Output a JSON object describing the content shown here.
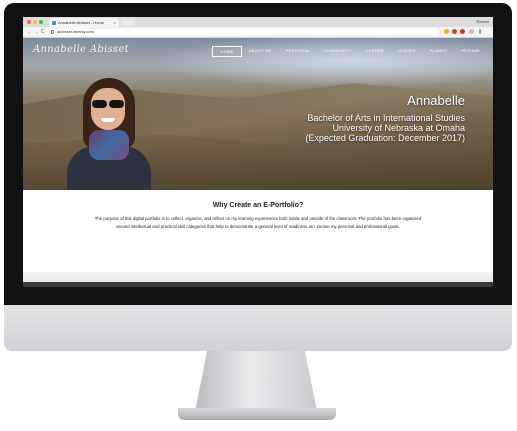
{
  "browser": {
    "tab_title": "Annabelle Abisset - Home",
    "tab_close": "×",
    "profile_name": "Rachel",
    "url": "aabisset.weebly.com",
    "back": "←",
    "forward": "→",
    "reload": "C"
  },
  "site": {
    "logo": "Annabelle Abisset",
    "nav": [
      "HOME",
      "ABOUT ME",
      "PERSONAL",
      "COMMUNITY",
      "CAREER",
      "LEADER",
      "PLANET",
      "RESUME"
    ],
    "active_nav": "HOME",
    "hero": {
      "name": "Annabelle",
      "lines": [
        "Bachelor of Arts in International Studies",
        "University of Nebraska at Omaha",
        "(Expected Graduation: December 2017)"
      ]
    },
    "section": {
      "title": "Why Create an E-Portfolio?",
      "body": "The purpose of this digital portfolio is to collect, organize, and reflect on my learning experiences both inside and outside of the classroom. The portfolio has been organized around intellectual and practical skill categories that help to demonstrate a general level of readiness as I pursue my personal and professional goals."
    }
  },
  "device": {
    "logo_glyph": "",
    "colors": {
      "bezel": "#111111",
      "chin": "#d8d9db",
      "accent_blue": "#3b8fd9"
    }
  }
}
